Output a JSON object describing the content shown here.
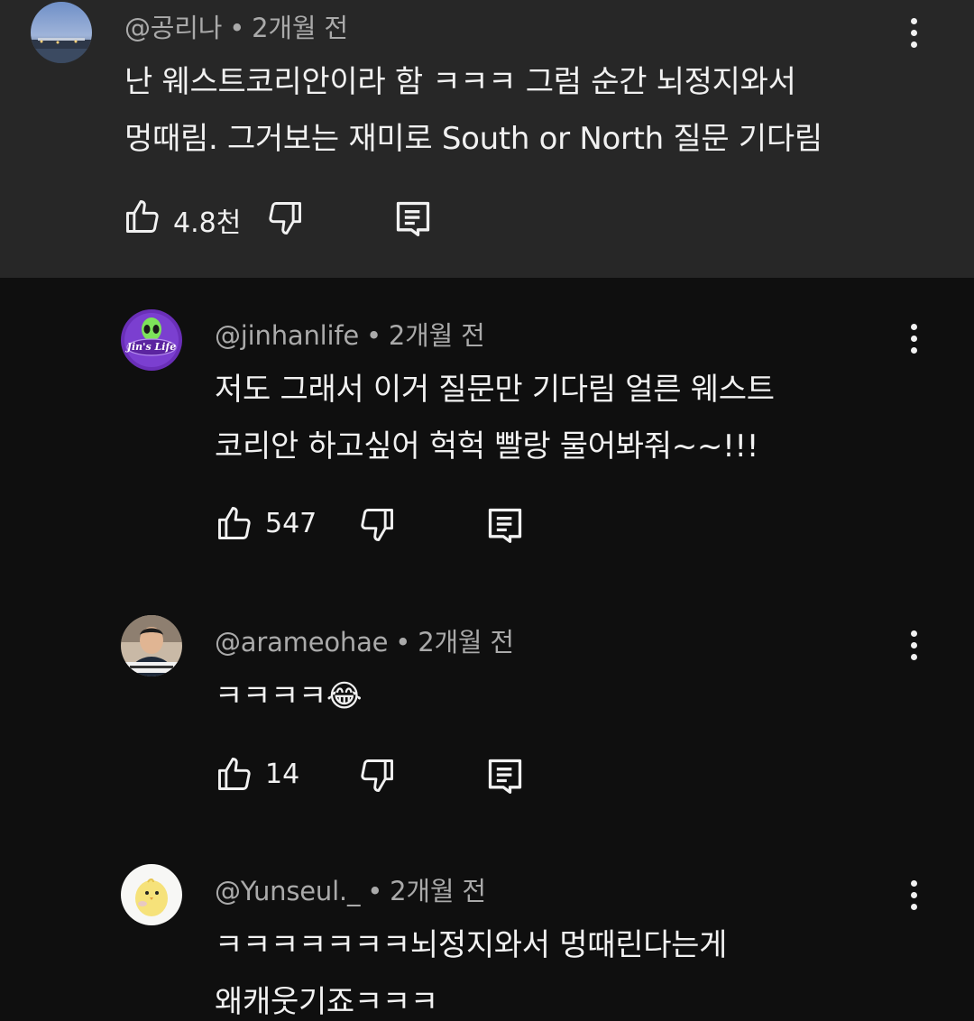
{
  "comments": [
    {
      "handle": "@공리나",
      "separator": "•",
      "time": "2개월 전",
      "lines": [
        "난 웨스트코리안이라 함 ㅋㅋㅋ 그럼 순간 뇌정지와서",
        "멍때림. 그거보는 재미로 South or North 질문 기다림"
      ],
      "likes": "4.8천",
      "avatar_icon": "night-city-avatar"
    },
    {
      "handle": "@jinhanlife",
      "separator": "•",
      "time": "2개월 전",
      "lines": [
        "저도 그래서 이거 질문만 기다림 얼른 웨스트",
        "코리안 하고싶어 헉헉 빨랑 물어봐줘~~!!!"
      ],
      "likes": "547",
      "avatar_icon": "alien-avatar",
      "avatar_text": "Jin's Life"
    },
    {
      "handle": "@arameohae",
      "separator": "•",
      "time": "2개월 전",
      "lines": [
        "ㅋㅋㅋㅋ😂"
      ],
      "likes": "14",
      "avatar_icon": "person-avatar"
    },
    {
      "handle": "@Yunseul._",
      "separator": "•",
      "time": "2개월 전",
      "lines": [
        "ㅋㅋㅋㅋㅋㅋㅋ뇌정지와서 멍때린다는게",
        "왜캐웃기죠ㅋㅋㅋ"
      ],
      "avatar_icon": "chick-avatar"
    }
  ],
  "icons": {
    "like": "thumbs-up-icon",
    "dislike": "thumbs-down-icon",
    "reply": "reply-icon",
    "more": "more-vert-icon"
  },
  "colors": {
    "background": "#0f0f0f",
    "highlight": "#272727",
    "meta": "#aaaaaa",
    "text": "#f1f1f1"
  }
}
